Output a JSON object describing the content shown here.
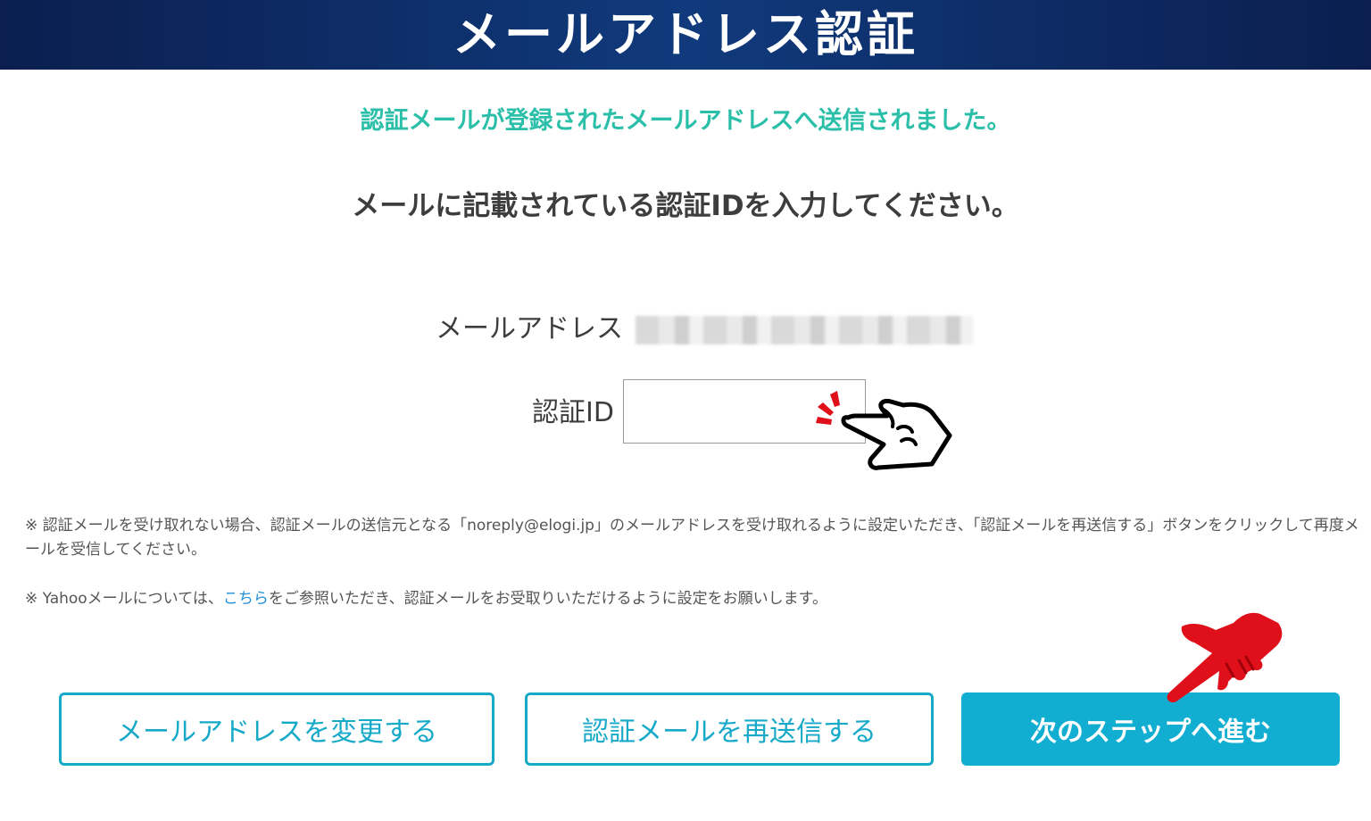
{
  "banner": {
    "title": "メールアドレス認証"
  },
  "notice": "認証メールが登録されたメールアドレスへ送信されました。",
  "instruction": "メールに記載されている認証IDを入力してください。",
  "form": {
    "email_label": "メールアドレス",
    "auth_id_label": "認証ID",
    "auth_id_value": "",
    "auth_id_placeholder": ""
  },
  "footnotes": {
    "first": "※ 認証メールを受け取れない場合、認証メールの送信元となる「noreply@elogi.jp」のメールアドレスを受け取れるように設定いただき、「認証メールを再送信する」ボタンをクリックして再度メールを受信してください。",
    "second_before": "※ Yahooメールについては、",
    "second_link": "こちら",
    "second_after": "をご参照いただき、認証メールをお受取りいただけるように設定をお願いします。"
  },
  "buttons": {
    "change_email": "メールアドレスを変更する",
    "resend": "認証メールを再送信する",
    "next_step": "次のステップへ進む"
  },
  "icons": {
    "input_pointer": "pointing-hand-icon",
    "button_pointer": "red-pointing-hand-icon",
    "click_marks": "click-burst-icon"
  },
  "colors": {
    "banner": "#0b1e4f",
    "notice": "#2bbfa9",
    "accent": "#11aed2",
    "link": "#1e8fd8",
    "pointer_red": "#e0101a"
  }
}
